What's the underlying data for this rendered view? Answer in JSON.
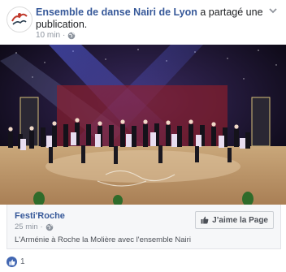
{
  "post": {
    "page_name": "Ensemble de danse Nairi de Lyon",
    "action_text": " a partagé une publication.",
    "time": "10 min"
  },
  "attachment": {
    "title": "Festi'Roche",
    "time": "25 min",
    "like_page_label": "J’aime la Page",
    "description": "L'Arménie à Roche la Molière avec l'ensemble Nairi"
  },
  "reactions": {
    "count": "1"
  },
  "colors": {
    "link": "#365899",
    "meta": "#8d949e",
    "like_blue": "#4267b2",
    "attachment_bg": "#f6f7f9"
  },
  "icons": {
    "globe": "globe-icon",
    "menu": "chevron-down-icon",
    "like": "thumbs-up-icon"
  }
}
